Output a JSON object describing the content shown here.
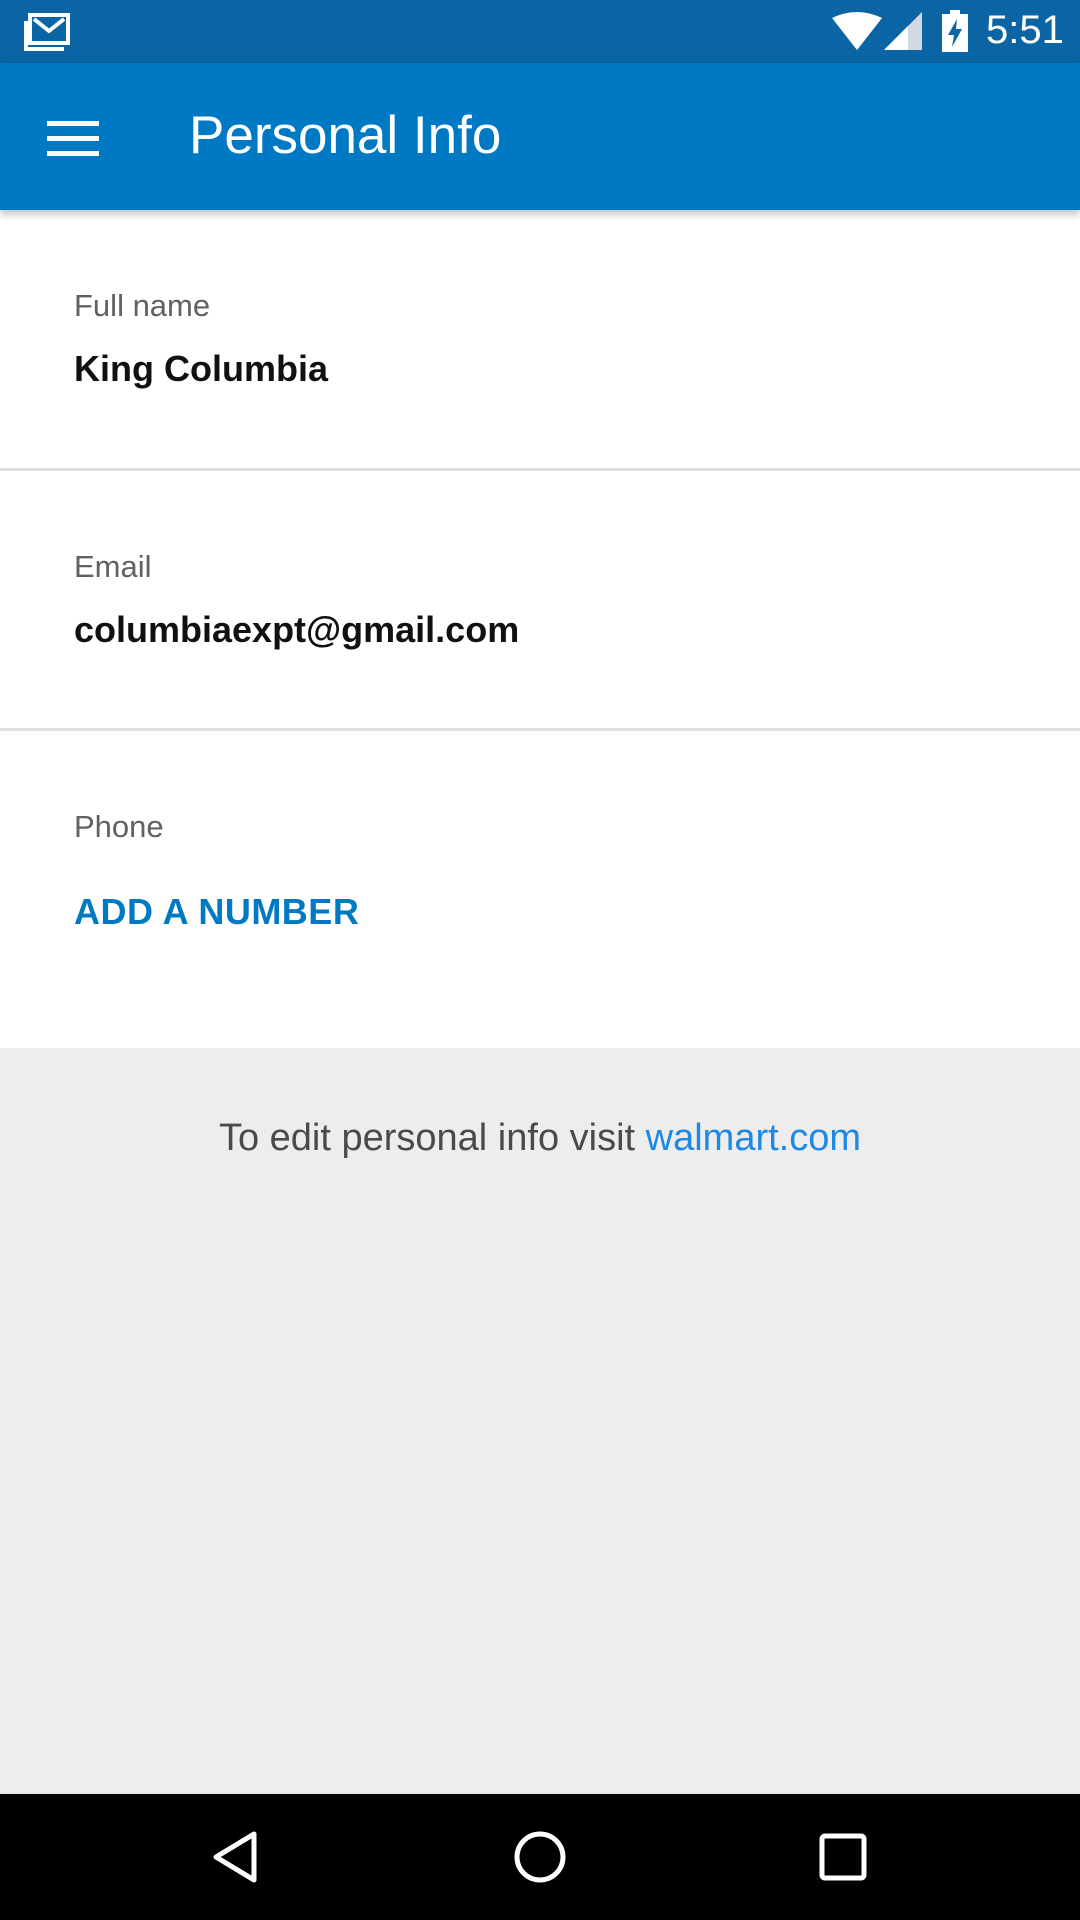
{
  "status_bar": {
    "time": "5:51",
    "icons": [
      "gmail-notification-icon",
      "wifi-icon",
      "signal-icon",
      "battery-charging-icon"
    ]
  },
  "app_bar": {
    "title": "Personal Info",
    "menu_icon": "hamburger-menu-icon",
    "color": "#0079c4"
  },
  "fields": {
    "full_name": {
      "label": "Full name",
      "value": "King Columbia"
    },
    "email": {
      "label": "Email",
      "value": "columbiaexpt@gmail.com"
    },
    "phone": {
      "label": "Phone",
      "action": "ADD A NUMBER"
    }
  },
  "footer": {
    "text": "To edit personal info visit ",
    "link": "walmart.com"
  },
  "nav_bar": {
    "icons": [
      "back-icon",
      "home-icon",
      "recents-icon"
    ]
  }
}
